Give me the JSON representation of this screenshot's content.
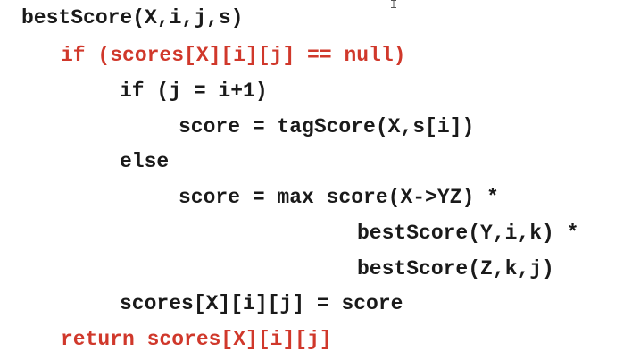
{
  "colors": {
    "text": "#1a1a1a",
    "highlight": "#d0382b",
    "background": "#ffffff"
  },
  "code": {
    "lines": [
      "bestScore(X,i,j,s)",
      "if (scores[X][i][j] == null)",
      "if (j = i+1)",
      "score = tagScore(X,s[i])",
      "else",
      "score = max score(X->YZ) *",
      "bestScore(Y,i,k) *",
      "bestScore(Z,k,j)",
      "scores[X][i][j] = score",
      "return scores[X][i][j]"
    ]
  },
  "icons": {
    "cursor": "text-cursor-icon"
  }
}
